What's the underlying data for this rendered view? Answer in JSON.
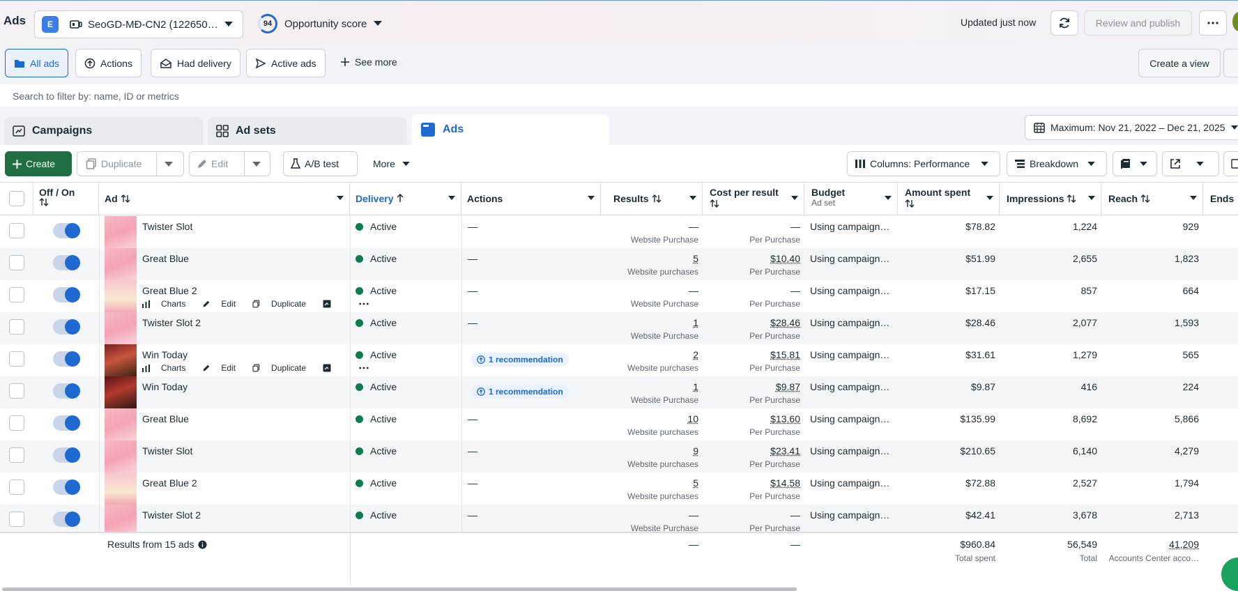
{
  "header": {
    "app_title": "Ads",
    "account_badge": "E",
    "account_name": "SeoGD-MĐ-CN2 (122650…",
    "opportunity_score": "94",
    "opportunity_label": "Opportunity score",
    "updated": "Updated just now",
    "review_publish": "Review and publish"
  },
  "views": {
    "items": [
      "All ads",
      "Actions",
      "Had delivery",
      "Active ads"
    ],
    "see_more": "See more",
    "create_view": "Create a view"
  },
  "search": {
    "placeholder": "Search to filter by: name, ID or metrics"
  },
  "tabs": {
    "campaigns": "Campaigns",
    "adsets": "Ad sets",
    "ads": "Ads",
    "date_range": "Maximum: Nov 21, 2022 – Dec 21, 2025"
  },
  "toolbar": {
    "create": "Create",
    "duplicate": "Duplicate",
    "edit": "Edit",
    "ab_test": "A/B test",
    "more": "More",
    "columns": "Columns: Performance",
    "breakdown": "Breakdown"
  },
  "columns": {
    "offon": "Off / On",
    "ad": "Ad",
    "delivery": "Delivery",
    "actions": "Actions",
    "results": "Results",
    "cost_per_result": "Cost per result",
    "budget": "Budget",
    "budget_sub": "Ad set",
    "amount_spent": "Amount spent",
    "impressions": "Impressions",
    "reach": "Reach",
    "ends": "Ends"
  },
  "row_actions": {
    "charts": "Charts",
    "edit": "Edit",
    "duplicate": "Duplicate"
  },
  "rows": [
    {
      "name": "Twister Slot",
      "delivery": "Active",
      "actions": "—",
      "results": "—",
      "results_sub": "Website Purchase",
      "cost": "—",
      "cost_sub": "Per Purchase",
      "budget": "Using campaign…",
      "spent": "$78.82",
      "impressions": "1,224",
      "reach": "929"
    },
    {
      "name": "Great Blue",
      "delivery": "Active",
      "actions": "—",
      "results": "5",
      "results_sub": "Website purchases",
      "cost": "$10.40",
      "cost_sub": "Per Purchase",
      "budget": "Using campaign…",
      "spent": "$51.99",
      "impressions": "2,655",
      "reach": "1,823"
    },
    {
      "name": "Great Blue 2",
      "delivery": "Active",
      "actions": "—",
      "results": "—",
      "results_sub": "Website Purchase",
      "cost": "—",
      "cost_sub": "Per Purchase",
      "budget": "Using campaign…",
      "spent": "$17.15",
      "impressions": "857",
      "reach": "664"
    },
    {
      "name": "Twister Slot 2",
      "delivery": "Active",
      "actions": "—",
      "results": "1",
      "results_sub": "Website Purchase",
      "cost": "$28.46",
      "cost_sub": "Per Purchase",
      "budget": "Using campaign…",
      "spent": "$28.46",
      "impressions": "2,077",
      "reach": "1,593"
    },
    {
      "name": "Win Today",
      "delivery": "Active",
      "actions": "1 recommendation",
      "results": "2",
      "results_sub": "Website purchases",
      "cost": "$15.81",
      "cost_sub": "Per Purchase",
      "budget": "Using campaign…",
      "spent": "$31.61",
      "impressions": "1,279",
      "reach": "565"
    },
    {
      "name": "Win Today",
      "delivery": "Active",
      "actions": "1 recommendation",
      "results": "1",
      "results_sub": "Website Purchase",
      "cost": "$9.87",
      "cost_sub": "Per Purchase",
      "budget": "Using campaign…",
      "spent": "$9.87",
      "impressions": "416",
      "reach": "224"
    },
    {
      "name": "Great Blue",
      "delivery": "Active",
      "actions": "—",
      "results": "10",
      "results_sub": "Website purchases",
      "cost": "$13.60",
      "cost_sub": "Per Purchase",
      "budget": "Using campaign…",
      "spent": "$135.99",
      "impressions": "8,692",
      "reach": "5,866"
    },
    {
      "name": "Twister Slot",
      "delivery": "Active",
      "actions": "—",
      "results": "9",
      "results_sub": "Website purchases",
      "cost": "$23.41",
      "cost_sub": "Per Purchase",
      "budget": "Using campaign…",
      "spent": "$210.65",
      "impressions": "6,140",
      "reach": "4,279"
    },
    {
      "name": "Great Blue 2",
      "delivery": "Active",
      "actions": "—",
      "results": "5",
      "results_sub": "Website purchases",
      "cost": "$14.58",
      "cost_sub": "Per Purchase",
      "budget": "Using campaign…",
      "spent": "$72.88",
      "impressions": "2,527",
      "reach": "1,794"
    },
    {
      "name": "Twister Slot 2",
      "delivery": "Active",
      "actions": "—",
      "results": "—",
      "results_sub": "Website Purchase",
      "cost": "—",
      "cost_sub": "Per Purchase",
      "budget": "Using campaign…",
      "spent": "$42.41",
      "impressions": "3,678",
      "reach": "2,713"
    }
  ],
  "footer": {
    "label": "Results from 15 ads",
    "results": "—",
    "cost": "—",
    "spent": "$960.84",
    "spent_sub": "Total spent",
    "impressions": "56,549",
    "impressions_sub": "Total",
    "reach": "41,209",
    "reach_sub": "Accounts Center acco…"
  },
  "colors": {
    "accent": "#1e69d2",
    "create_green": "#1f6f43",
    "active_dot": "#0b7d4f"
  }
}
